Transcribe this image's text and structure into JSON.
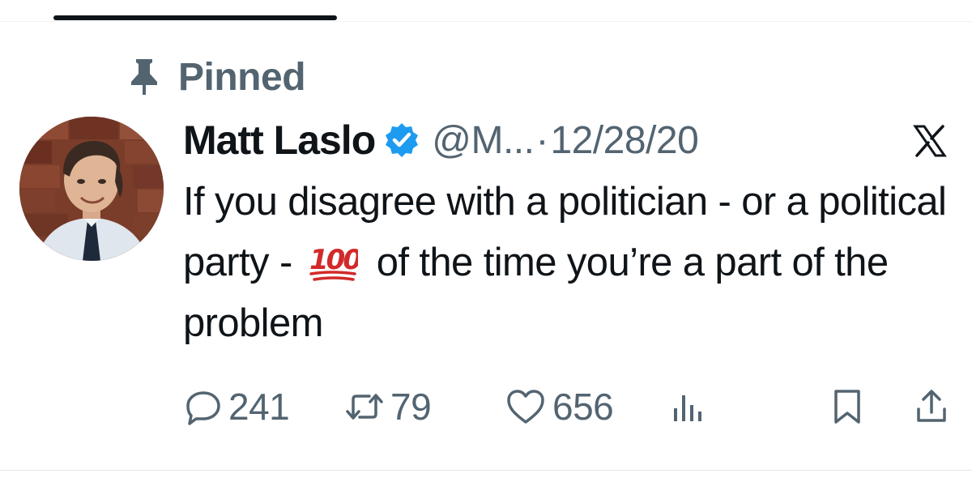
{
  "header": {
    "pinned_label": "Pinned"
  },
  "post": {
    "author_name": "Matt Laslo",
    "handle": "@M...",
    "separator": "·",
    "date": "12/28/20",
    "text_before_emoji": "If you disagree with a politician - or a political party - ",
    "emoji": "💯",
    "text_after_emoji": " of the time you’re a part of the problem"
  },
  "actions": {
    "replies": "241",
    "reposts": "79",
    "likes": "656"
  },
  "icons": {
    "pin": "pin-icon",
    "verified": "verified-badge-icon",
    "platform": "x-logo-icon",
    "reply": "reply-icon",
    "repost": "repost-icon",
    "like": "heart-icon",
    "views": "bar-chart-icon",
    "bookmark": "bookmark-icon",
    "share": "share-icon"
  },
  "colors": {
    "text_primary": "#0f1419",
    "text_secondary": "#536471",
    "verified_blue": "#1d9bf0",
    "emoji_red": "#d22a2a"
  }
}
